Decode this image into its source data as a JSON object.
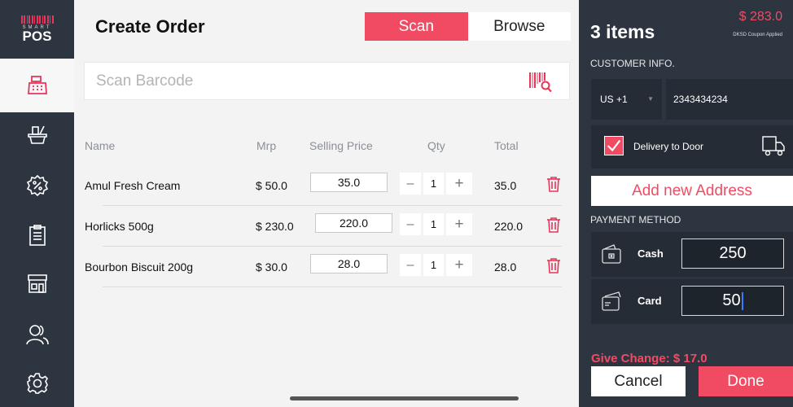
{
  "brand": {
    "logo_top": "SMART",
    "logo_bottom": "POS"
  },
  "nav": {
    "items": [
      {
        "icon": "cash-register-icon",
        "active": true
      },
      {
        "icon": "basket-icon",
        "active": false
      },
      {
        "icon": "discount-badge-icon",
        "active": false
      },
      {
        "icon": "clipboard-icon",
        "active": false
      },
      {
        "icon": "store-icon",
        "active": false
      },
      {
        "icon": "customers-icon",
        "active": false
      },
      {
        "icon": "settings-gear-icon",
        "active": false
      }
    ]
  },
  "header": {
    "title": "Create Order",
    "scan_label": "Scan",
    "browse_label": "Browse",
    "active_mode": "Scan"
  },
  "search": {
    "placeholder": "Scan Barcode",
    "icon": "barcode-scan-icon"
  },
  "table": {
    "headers": {
      "name": "Name",
      "mrp": "Mrp",
      "selling_price": "Selling Price",
      "qty": "Qty",
      "total": "Total"
    },
    "rows": [
      {
        "name": "Amul Fresh Cream",
        "mrp": "$ 50.0",
        "selling_price": "35.0",
        "qty": "1",
        "total": "35.0"
      },
      {
        "name": "Horlicks 500g",
        "mrp": "$ 230.0",
        "selling_price": "220.0",
        "qty": "1",
        "total": "220.0"
      },
      {
        "name": "Bourbon Biscuit 200g",
        "mrp": "$ 30.0",
        "selling_price": "28.0",
        "qty": "1",
        "total": "28.0"
      }
    ],
    "minus_symbol": "–",
    "plus_symbol": "+"
  },
  "summary": {
    "item_count": "3 items",
    "total": "$ 283.0",
    "coupon_note": "DKSD Coupon Applied",
    "customer_label": "CUSTOMER INFO.",
    "country_code": "US +1",
    "dropdown_glyph": "▼",
    "phone": "2343434234",
    "delivery_label": "Delivery to Door",
    "delivery_checked": true,
    "add_address": "Add new Address",
    "payment_label": "PAYMENT METHOD",
    "cash_label": "Cash",
    "cash_amount": "250",
    "card_label": "Card",
    "card_amount": "50",
    "change_text": "Give Change: $ 17.0",
    "cancel_label": "Cancel",
    "done_label": "Done"
  },
  "colors": {
    "accent": "#f14b63",
    "panel": "#2d3540",
    "field": "#252c35"
  }
}
